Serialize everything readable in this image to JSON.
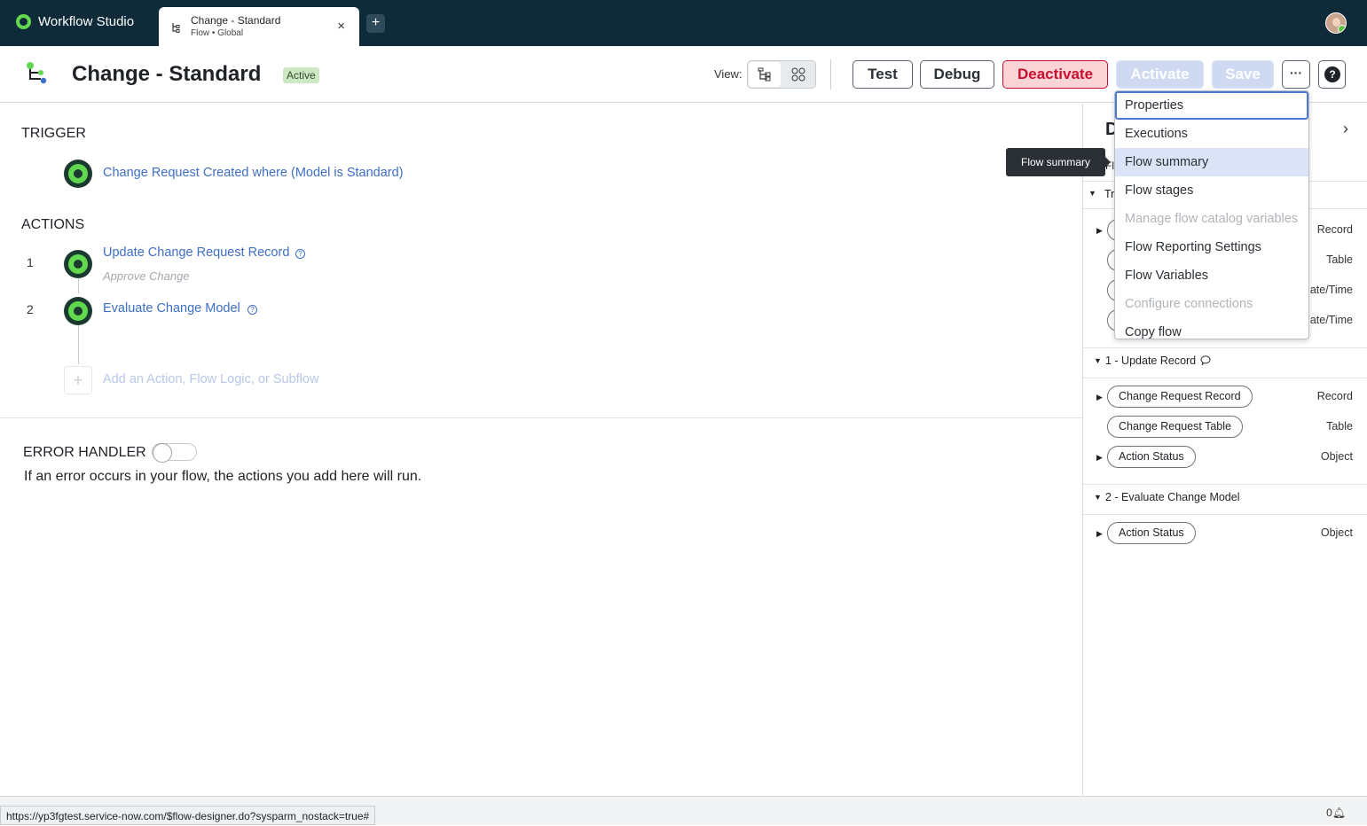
{
  "topbar": {
    "app_name": "Workflow Studio",
    "tab": {
      "title": "Change - Standard",
      "subtitle": "Flow • Global",
      "close": "×"
    },
    "add_tab": "+"
  },
  "header": {
    "title": "Change - Standard",
    "status": "Active",
    "view_label": "View:",
    "buttons": {
      "test": "Test",
      "debug": "Debug",
      "deactivate": "Deactivate",
      "activate": "Activate",
      "save": "Save",
      "more": "···",
      "help": "?"
    }
  },
  "canvas": {
    "trigger_heading": "TRIGGER",
    "trigger_link": "Change Request Created where (Model is Standard)",
    "actions_heading": "ACTIONS",
    "actions": [
      {
        "number": "1",
        "label": "Update Change Request Record",
        "sublabel": "Approve Change"
      },
      {
        "number": "2",
        "label": "Evaluate Change Model",
        "sublabel": ""
      }
    ],
    "add_action": "Add an Action, Flow Logic, or Subflow",
    "error_handler": {
      "heading": "ERROR HANDLER",
      "description": "If an error occurs in your flow, the actions you add here will run."
    }
  },
  "right_panel": {
    "title_fragment": "D",
    "row_fragment_1": "Fl",
    "section_fragment": "Tr",
    "partial_types": [
      "Record",
      "Table",
      "ate/Time",
      "ate/Time"
    ],
    "sections": [
      {
        "title": "1 - Update Record",
        "items": [
          {
            "label": "Change Request Record",
            "type": "Record",
            "expandable": true
          },
          {
            "label": "Change Request Table",
            "type": "Table",
            "expandable": false
          },
          {
            "label": "Action Status",
            "type": "Object",
            "expandable": true
          }
        ]
      },
      {
        "title": "2 - Evaluate Change Model",
        "items": [
          {
            "label": "Action Status",
            "type": "Object",
            "expandable": true
          }
        ]
      }
    ]
  },
  "more_menu": {
    "items": [
      {
        "label": "Properties",
        "state": "focused"
      },
      {
        "label": "Executions",
        "state": "normal"
      },
      {
        "label": "Flow summary",
        "state": "hover"
      },
      {
        "label": "Flow stages",
        "state": "normal"
      },
      {
        "label": "Manage flow catalog variables",
        "state": "disabled"
      },
      {
        "label": "Flow Reporting Settings",
        "state": "normal"
      },
      {
        "label": "Flow Variables",
        "state": "normal"
      },
      {
        "label": "Configure connections",
        "state": "disabled"
      },
      {
        "label": "Copy flow",
        "state": "normal"
      }
    ]
  },
  "tooltip": "Flow summary",
  "footer": {
    "url": "https://yp3fgtest.service-now.com/$flow-designer.do?sysparm_nostack=true#",
    "notification_count": "0"
  }
}
